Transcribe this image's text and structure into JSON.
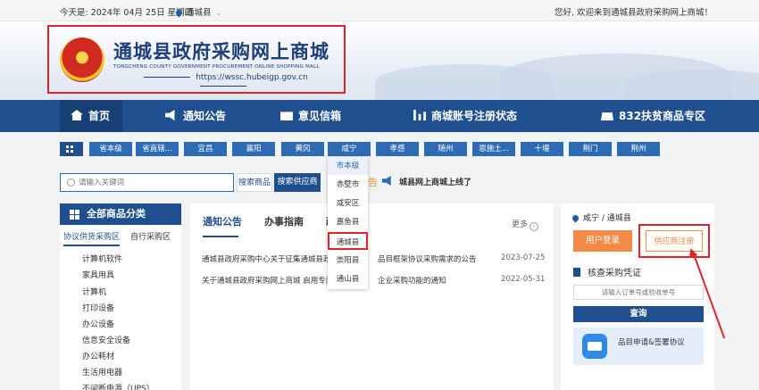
{
  "topbar": {
    "date": "今天是: 2024年 04月 25日 星期四",
    "location": "通城县",
    "welcome": "您好, 欢迎来到通城县政府采购网上商城！"
  },
  "banner": {
    "title": "通城县政府采购网上商城",
    "subtitle_en": "TONGCHENG COUNTY GOVERNMENT PROCUREMENT ONLINE SHOPPING MALL",
    "url": "https://wssc.hubeigp.gov.cn"
  },
  "nav": {
    "items": [
      "首页",
      "通知公告",
      "意见信箱",
      "商城账号注册状态",
      "832扶贫商品专区"
    ]
  },
  "regions": [
    "省本级",
    "省直辖...",
    "宜昌",
    "襄阳",
    "黄冈",
    "咸宁",
    "孝感",
    "随州",
    "恩施土...",
    "十堰",
    "荆门",
    "荆州"
  ],
  "region_dropdown": [
    "市本级",
    "赤壁市",
    "咸安区",
    "嘉鱼县",
    "通城县",
    "崇阳县",
    "通山县"
  ],
  "search": {
    "placeholder": "请输入关键词",
    "btn_goods": "搜索商品",
    "btn_supplier": "搜索供应商",
    "marquee_prefix": "告",
    "marquee": "城县网上商城上线了"
  },
  "categories": {
    "header": "全部商品分类",
    "tabs": [
      "协议供货采购区",
      "自行采购区"
    ],
    "items": [
      "计算机软件",
      "家具用具",
      "计算机",
      "打印设备",
      "办公设备",
      "信息安全设备",
      "办公耗材",
      "生活用电器",
      "不间断电源（UPS）"
    ]
  },
  "notices": {
    "tabs": [
      "通知公告",
      "办事指南",
      "政"
    ],
    "more": "更多",
    "rows": [
      {
        "title": "通城县政府采购中心关于征集通城县政",
        "title_tail": "品目框架协议采购需求的公告",
        "date": "2023-07-25"
      },
      {
        "title": "关于通城县政府采购网上商城 启用专门",
        "title_tail": "企业采购功能的通知",
        "date": "2022-05-31"
      }
    ]
  },
  "right": {
    "location": "咸宁 / 通城县",
    "login": "用户登录",
    "supplier_register": "供应商注册",
    "verify_title": "核查采购凭证",
    "verify_placeholder": "请输入订单号或验收单号",
    "query": "查询",
    "card_text": "品目申请&签署协议"
  }
}
